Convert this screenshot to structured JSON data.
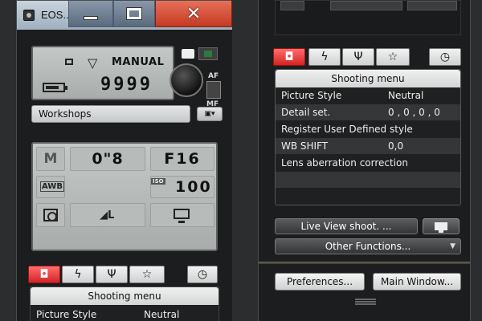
{
  "left_window": {
    "title": "EOS...",
    "close_glyph": "✕",
    "lcd_top": {
      "quality": "MANUAL",
      "shots_remaining": "9999"
    },
    "af_label": "AF",
    "mf_label": "MF",
    "workshops_field": "Workshops",
    "camera_dropdown": "▣▾",
    "lcd_main": {
      "mode": "M",
      "shutter_speed": "0\"8",
      "aperture": "F16",
      "white_balance": "AWB",
      "iso_label": "ISO",
      "iso_value": "100",
      "drive_glyph": "◢L"
    },
    "tabs": [
      {
        "glyph": "◘",
        "icon": "camera-icon"
      },
      {
        "glyph": "ϟ",
        "icon": "flash-icon"
      },
      {
        "glyph": "Ψ",
        "icon": "tools-icon"
      },
      {
        "glyph": "☆",
        "icon": "star-icon"
      },
      {
        "glyph": "◷",
        "icon": "timer-icon"
      }
    ],
    "menu": {
      "header": "Shooting menu",
      "rows": [
        {
          "label": "Picture Style",
          "value": "Neutral"
        }
      ]
    }
  },
  "right_window": {
    "tabs": [
      {
        "glyph": "◘",
        "icon": "camera-icon"
      },
      {
        "glyph": "ϟ",
        "icon": "flash-icon"
      },
      {
        "glyph": "Ψ",
        "icon": "tools-icon"
      },
      {
        "glyph": "☆",
        "icon": "star-icon"
      },
      {
        "glyph": "◷",
        "icon": "timer-icon"
      }
    ],
    "menu": {
      "header": "Shooting menu",
      "rows": [
        {
          "label": "Picture Style",
          "value": "Neutral"
        },
        {
          "label": "Detail set.",
          "value": "0 , 0 , 0 , 0"
        },
        {
          "label": "Register User Defined style",
          "value": ""
        },
        {
          "label": "WB SHIFT",
          "value": "0,0"
        },
        {
          "label": "Lens aberration correction",
          "value": ""
        }
      ]
    },
    "liveview_button": "Live View shoot. ...",
    "other_functions_button": "Other Functions...",
    "other_functions_chevron": "▼",
    "preferences_button": "Preferences...",
    "main_window_button": "Main Window..."
  },
  "colors": {
    "active_tab": "#e03030",
    "close_button": "#d04a32",
    "lcd_background": "#b8bcba"
  }
}
